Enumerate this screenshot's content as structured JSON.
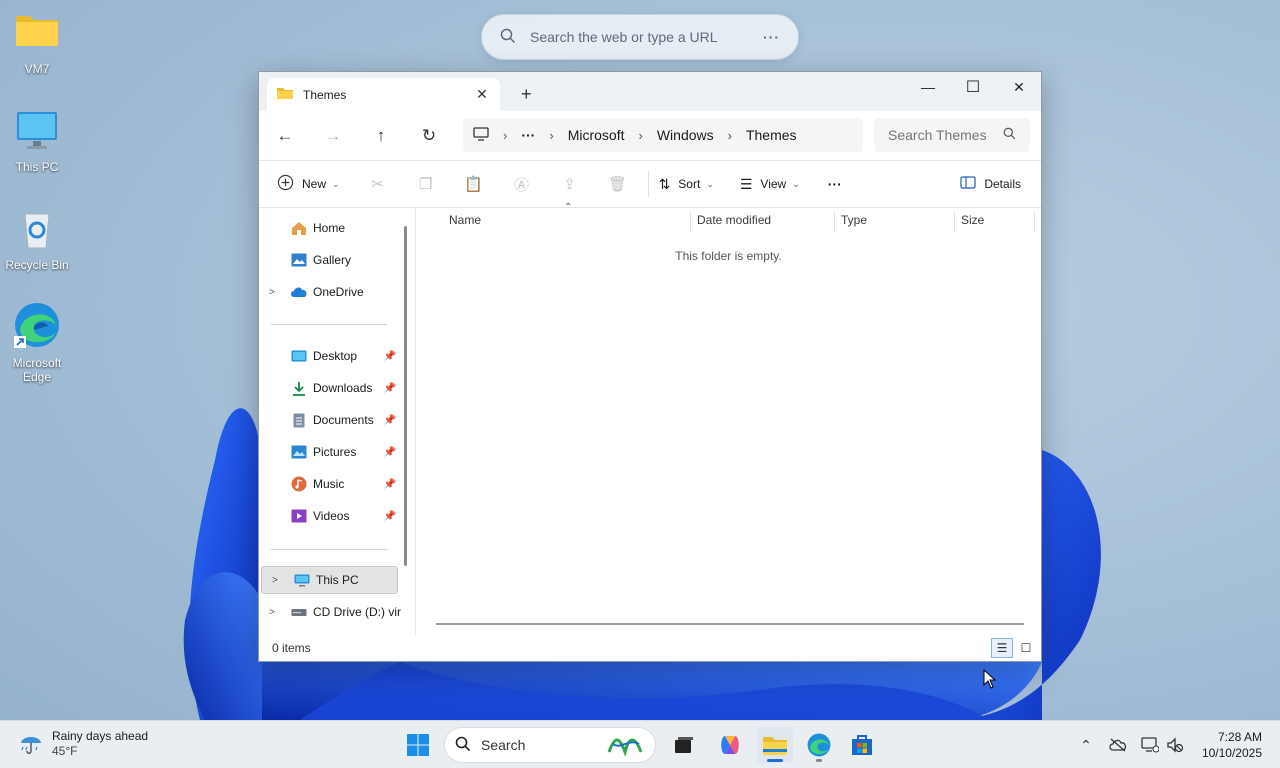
{
  "desktop": {
    "icons": [
      {
        "label": "VM7"
      },
      {
        "label": "This PC"
      },
      {
        "label": "Recycle Bin"
      },
      {
        "label": "Microsoft Edge"
      }
    ]
  },
  "web_search": {
    "placeholder": "Search the web or type a URL",
    "more": "···"
  },
  "window": {
    "tab_title": "Themes",
    "tab_close": "✕",
    "new_tab": "+",
    "controls": {
      "minimize": "—",
      "maximize": "☐",
      "close": "✕"
    },
    "nav": {
      "back": "←",
      "forward": "→",
      "up": "↑",
      "refresh": "↻"
    },
    "breadcrumb": {
      "ellipsis": "···",
      "items": [
        "Microsoft",
        "Windows",
        "Themes"
      ],
      "sep": "›"
    },
    "search_placeholder": "Search Themes",
    "toolbar": {
      "new_label": "New",
      "sort_label": "Sort",
      "view_label": "View",
      "more": "···",
      "details_label": "Details"
    },
    "sidebar": {
      "items": [
        {
          "label": "Home"
        },
        {
          "label": "Gallery"
        },
        {
          "label": "OneDrive"
        },
        {
          "label": "Desktop"
        },
        {
          "label": "Downloads"
        },
        {
          "label": "Documents"
        },
        {
          "label": "Pictures"
        },
        {
          "label": "Music"
        },
        {
          "label": "Videos"
        },
        {
          "label": "This PC"
        },
        {
          "label": "CD Drive (D:) vir"
        }
      ]
    },
    "columns": [
      "Name",
      "Date modified",
      "Type",
      "Size"
    ],
    "empty_message": "This folder is empty.",
    "status": "0 items"
  },
  "taskbar": {
    "weather_title": "Rainy days ahead",
    "weather_temp": "45°F",
    "search_label": "Search",
    "time": "7:28 AM",
    "date": "10/10/2025"
  }
}
